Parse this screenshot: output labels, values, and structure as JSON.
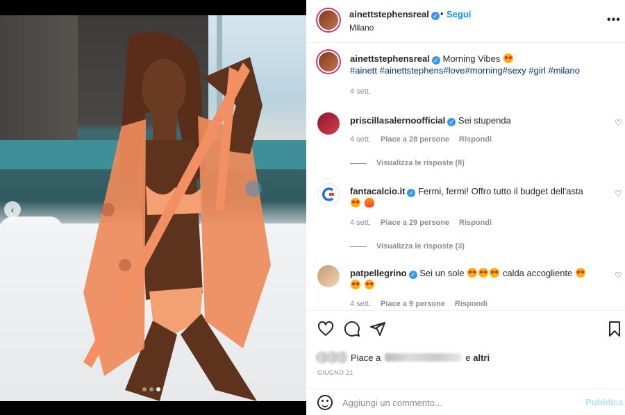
{
  "post": {
    "author": "ainettstephensreal",
    "follow_label": "Segui",
    "separator": "•",
    "location": "Milano",
    "more_label": "•••",
    "caption": {
      "author": "ainettstephensreal",
      "text": "Morning Vibes",
      "hashtags": "#ainett #ainettstephens#love#morning#sexy #girl #milano",
      "time": "4 sett."
    }
  },
  "comments": [
    {
      "author": "priscillasalernoofficial",
      "text": "Sei stupenda",
      "time": "4 sett.",
      "likes": "Piace a 28 persone",
      "reply": "Rispondi",
      "view_replies": "Visualizza le risposte (8)"
    },
    {
      "author": "fantacalcio.it",
      "text": "Fermi, fermi! Offro tutto il budget dell'asta",
      "time": "4 sett.",
      "likes": "Piace a 29 persone",
      "reply": "Rispondi",
      "view_replies": "Visualizza le risposte (3)"
    },
    {
      "author": "patpellegrino",
      "text_a": "Sei un sole",
      "text_b": "calda accogliente",
      "time": "4 sett.",
      "likes": "Piace a 9 persone",
      "reply": "Rispondi"
    }
  ],
  "likes_bar": {
    "prefix": "Piace a",
    "suffix_a": "e",
    "suffix_b": "altri"
  },
  "date": "GIUGNO 21",
  "add_comment": {
    "placeholder": "Aggiungi un commento...",
    "publish_label": "Pubblica"
  },
  "carousel": {
    "nav_prev": "‹",
    "slide_count": 3,
    "active_slide": 3
  },
  "colors": {
    "accent_link": "#0095f6",
    "verified": "#3897f0",
    "publish_disabled": "#b2dffc",
    "hashtag": "#00376b"
  },
  "icons": [
    "heart-icon",
    "comment-icon",
    "share-icon",
    "bookmark-icon",
    "emoji-icon",
    "verified-badge-icon",
    "chevron-left-icon",
    "more-icon"
  ]
}
